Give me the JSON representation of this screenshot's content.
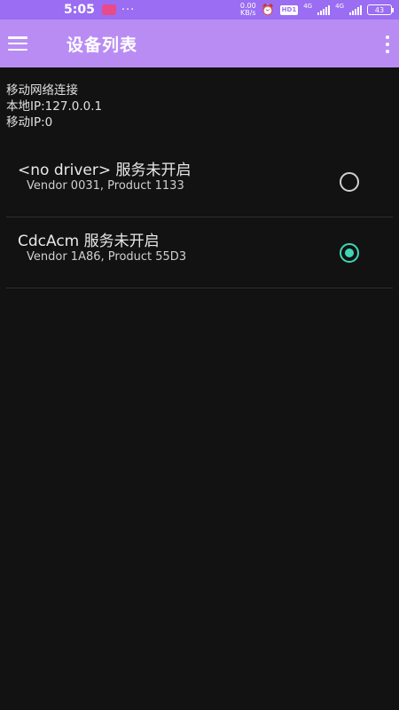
{
  "status_bar": {
    "time": "5:05",
    "dots": "···",
    "speed_top": "0.00",
    "speed_bottom": "KB/s",
    "hd_badge": "HD1",
    "net_label_1": "4G",
    "net_label_2": "4G",
    "battery": "43"
  },
  "app_bar": {
    "title": "设备列表"
  },
  "info": {
    "line1": "移动网络连接",
    "line2": "本地IP:127.0.0.1",
    "line3": "移动IP:0"
  },
  "devices": [
    {
      "name": "<no driver> 服务未开启",
      "sub": "Vendor 0031, Product 1133",
      "selected": false
    },
    {
      "name": "CdcAcm 服务未开启",
      "sub": "Vendor 1A86, Product 55D3",
      "selected": true
    }
  ],
  "colors": {
    "status_bar": "#9a6df2",
    "app_bar": "#b98cf3",
    "background": "#121212",
    "radio_accent": "#3fd6b6"
  },
  "icons": [
    "menu-icon",
    "more-vert-icon",
    "radio-unchecked-icon",
    "radio-checked-icon"
  ]
}
